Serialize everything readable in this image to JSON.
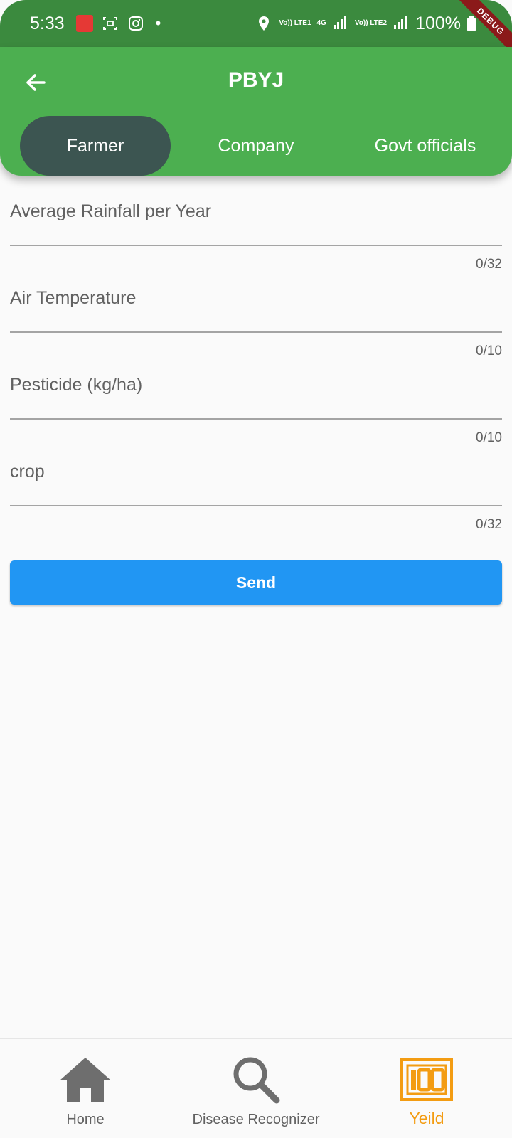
{
  "status_bar": {
    "time": "5:33",
    "network1": "Vo)) LTE1",
    "network2": "4G",
    "network3": "Vo)) LTE2",
    "battery": "100%",
    "debug_label": "DEBUG"
  },
  "app_bar": {
    "title": "PBYJ",
    "tabs": [
      {
        "label": "Farmer",
        "active": true
      },
      {
        "label": "Company",
        "active": false
      },
      {
        "label": "Govt officials",
        "active": false
      }
    ]
  },
  "form": {
    "fields": [
      {
        "label": "Average Rainfall per Year",
        "value": "",
        "counter": "0/32"
      },
      {
        "label": "Air Temperature",
        "value": "",
        "counter": "0/10"
      },
      {
        "label": "Pesticide (kg/ha)",
        "value": "",
        "counter": "0/10"
      },
      {
        "label": "crop",
        "value": "",
        "counter": "0/32"
      }
    ],
    "send_label": "Send"
  },
  "bottom_nav": {
    "items": [
      {
        "label": "Home",
        "icon": "home-icon",
        "active": false
      },
      {
        "label": "Disease Recognizer",
        "icon": "search-icon",
        "active": false
      },
      {
        "label": "Yeild",
        "icon": "hundred-icon",
        "active": true
      }
    ]
  },
  "colors": {
    "status_bar": "#3b8a3e",
    "app_bar": "#4caf50",
    "active_tab": "#3c5551",
    "send_button": "#2196f3",
    "active_nav": "#f39c12",
    "inactive_nav": "#616161"
  }
}
